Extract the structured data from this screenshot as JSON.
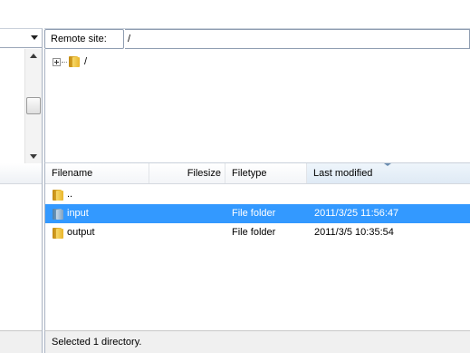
{
  "remote_site": {
    "label": "Remote site:",
    "path": "/"
  },
  "remote_tree": {
    "root_label": "/",
    "root_icon": "folder-icon",
    "expander_icon": "plus-expander-icon"
  },
  "file_list": {
    "columns": [
      "Filename",
      "Filesize",
      "Filetype",
      "Last modified"
    ],
    "sorted_column": "Last modified",
    "rows": [
      {
        "name": "..",
        "size": "",
        "type": "",
        "modified": "",
        "icon": "folder-icon",
        "selected": false
      },
      {
        "name": "input",
        "size": "",
        "type": "File folder",
        "modified": "2011/3/25 11:56:47",
        "icon": "folder-icon",
        "selected": true
      },
      {
        "name": "output",
        "size": "",
        "type": "File folder",
        "modified": "2011/3/5 10:35:54",
        "icon": "folder-icon",
        "selected": false
      }
    ]
  },
  "status": {
    "text": "Selected 1 directory."
  },
  "colors": {
    "selection": "#3399ff",
    "folder": "#f2c541",
    "selected_folder": "#9dbad3",
    "border": "#a9b3c2"
  }
}
